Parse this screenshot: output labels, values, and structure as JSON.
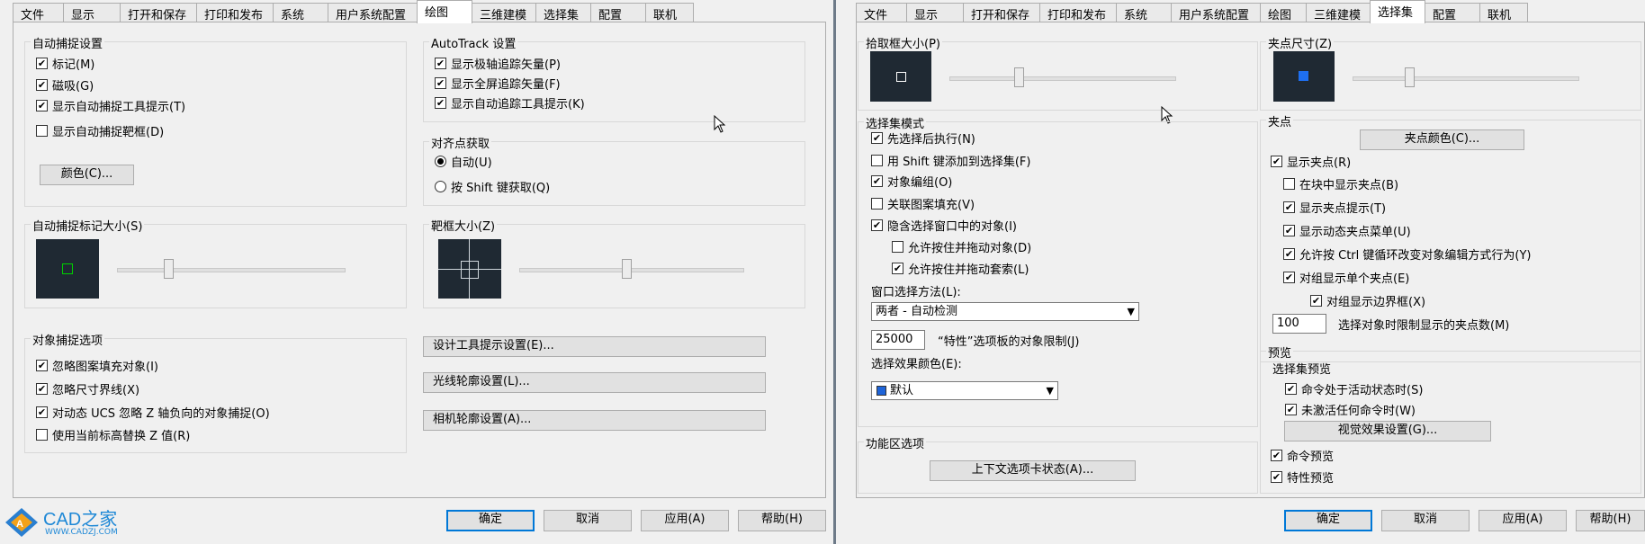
{
  "left": {
    "tabs": [
      {
        "label": "文件",
        "active": false
      },
      {
        "label": "显示",
        "active": false
      },
      {
        "label": "打开和保存",
        "active": false
      },
      {
        "label": "打印和发布",
        "active": false
      },
      {
        "label": "系统",
        "active": false
      },
      {
        "label": "用户系统配置",
        "active": false
      },
      {
        "label": "绘图",
        "active": true
      },
      {
        "label": "三维建模",
        "active": false
      },
      {
        "label": "选择集",
        "active": false
      },
      {
        "label": "配置",
        "active": false
      },
      {
        "label": "联机",
        "active": false
      }
    ],
    "autosnap": {
      "title": "自动捕捉设置",
      "items": [
        {
          "label": "标记(M)",
          "checked": true
        },
        {
          "label": "磁吸(G)",
          "checked": true
        },
        {
          "label": "显示自动捕捉工具提示(T)",
          "checked": true
        },
        {
          "label": "显示自动捕捉靶框(D)",
          "checked": false
        }
      ],
      "color_button": "颜色(C)..."
    },
    "autotrack": {
      "title": "AutoTrack 设置",
      "items": [
        {
          "label": "显示极轴追踪矢量(P)",
          "checked": true
        },
        {
          "label": "显示全屏追踪矢量(F)",
          "checked": true
        },
        {
          "label": "显示自动追踪工具提示(K)",
          "checked": true
        }
      ]
    },
    "alignment": {
      "title": "对齐点获取",
      "items": [
        {
          "label": "自动(U)",
          "selected": true
        },
        {
          "label": "按 Shift 键获取(Q)",
          "selected": false
        }
      ]
    },
    "marker_size": {
      "title": "自动捕捉标记大小(S)",
      "slider": 0.22
    },
    "aperture_size": {
      "title": "靶框大小(Z)",
      "slider": 0.47
    },
    "osnap": {
      "title": "对象捕捉选项",
      "items": [
        {
          "label": "忽略图案填充对象(I)",
          "checked": true
        },
        {
          "label": "忽略尺寸界线(X)",
          "checked": true
        },
        {
          "label": "对动态 UCS 忽略 Z 轴负向的对象捕捉(O)",
          "checked": true
        },
        {
          "label": "使用当前标高替换 Z 值(R)",
          "checked": false
        }
      ]
    },
    "buttons": {
      "design_tooltip": "设计工具提示设置(E)...",
      "light_glyph": "光线轮廓设置(L)...",
      "camera_glyph": "相机轮廓设置(A)..."
    },
    "footer": {
      "ok": "确定",
      "cancel": "取消",
      "apply": "应用(A)",
      "help": "帮助(H)"
    },
    "logo": {
      "text": "CAD之家",
      "url": "WWW.CADZJ.COM"
    }
  },
  "right": {
    "tabs": [
      {
        "label": "文件",
        "active": false
      },
      {
        "label": "显示",
        "active": false
      },
      {
        "label": "打开和保存",
        "active": false
      },
      {
        "label": "打印和发布",
        "active": false
      },
      {
        "label": "系统",
        "active": false
      },
      {
        "label": "用户系统配置",
        "active": false
      },
      {
        "label": "绘图",
        "active": false
      },
      {
        "label": "三维建模",
        "active": false
      },
      {
        "label": "选择集",
        "active": true
      },
      {
        "label": "配置",
        "active": false
      },
      {
        "label": "联机",
        "active": false
      }
    ],
    "pickbox": {
      "title": "拾取框大小(P)",
      "slider": 0.31
    },
    "gripsize": {
      "title": "夹点尺寸(Z)",
      "slider": 0.25
    },
    "selection_modes": {
      "title": "选择集模式",
      "items": [
        {
          "label": "先选择后执行(N)",
          "checked": true,
          "indent": 0
        },
        {
          "label": "用 Shift 键添加到选择集(F)",
          "checked": false,
          "indent": 0
        },
        {
          "label": "对象编组(O)",
          "checked": true,
          "indent": 0
        },
        {
          "label": "关联图案填充(V)",
          "checked": false,
          "indent": 0
        },
        {
          "label": "隐含选择窗口中的对象(I)",
          "checked": true,
          "indent": 0
        },
        {
          "label": "允许按住并拖动对象(D)",
          "checked": false,
          "indent": 1
        },
        {
          "label": "允许按住并拖动套索(L)",
          "checked": true,
          "indent": 1
        }
      ],
      "window_method_label": "窗口选择方法(L):",
      "window_method_value": "两者 - 自动检测",
      "limit_value": "25000",
      "limit_label": "“特性”选项板的对象限制(J)",
      "effect_color_label": "选择效果颜色(E):",
      "effect_color_value": "默认",
      "effect_color": "#1e64d8"
    },
    "ribbon": {
      "title": "功能区选项",
      "button": "上下文选项卡状态(A)..."
    },
    "grips": {
      "title": "夹点",
      "color_button": "夹点颜色(C)...",
      "items": [
        {
          "label": "显示夹点(R)",
          "checked": true,
          "indent": 0
        },
        {
          "label": "在块中显示夹点(B)",
          "checked": false,
          "indent": 1
        },
        {
          "label": "显示夹点提示(T)",
          "checked": true,
          "indent": 1
        },
        {
          "label": "显示动态夹点菜单(U)",
          "checked": true,
          "indent": 1
        },
        {
          "label": "允许按 Ctrl 键循环改变对象编辑方式行为(Y)",
          "checked": true,
          "indent": 1
        },
        {
          "label": "对组显示单个夹点(E)",
          "checked": true,
          "indent": 1
        },
        {
          "label": "对组显示边界框(X)",
          "checked": true,
          "indent": 2
        }
      ],
      "limit_value": "100",
      "limit_label": "选择对象时限制显示的夹点数(M)"
    },
    "preview": {
      "title": "预览",
      "subtitle": "选择集预览",
      "items": [
        {
          "label": "命令处于活动状态时(S)",
          "checked": true
        },
        {
          "label": "未激活任何命令时(W)",
          "checked": true
        }
      ],
      "visual_button": "视觉效果设置(G)...",
      "cmd_preview": {
        "label": "命令预览",
        "checked": true
      },
      "prop_preview": {
        "label": "特性预览",
        "checked": true
      }
    },
    "footer": {
      "ok": "确定",
      "cancel": "取消",
      "apply": "应用(A)",
      "help": "帮助(H)"
    }
  }
}
